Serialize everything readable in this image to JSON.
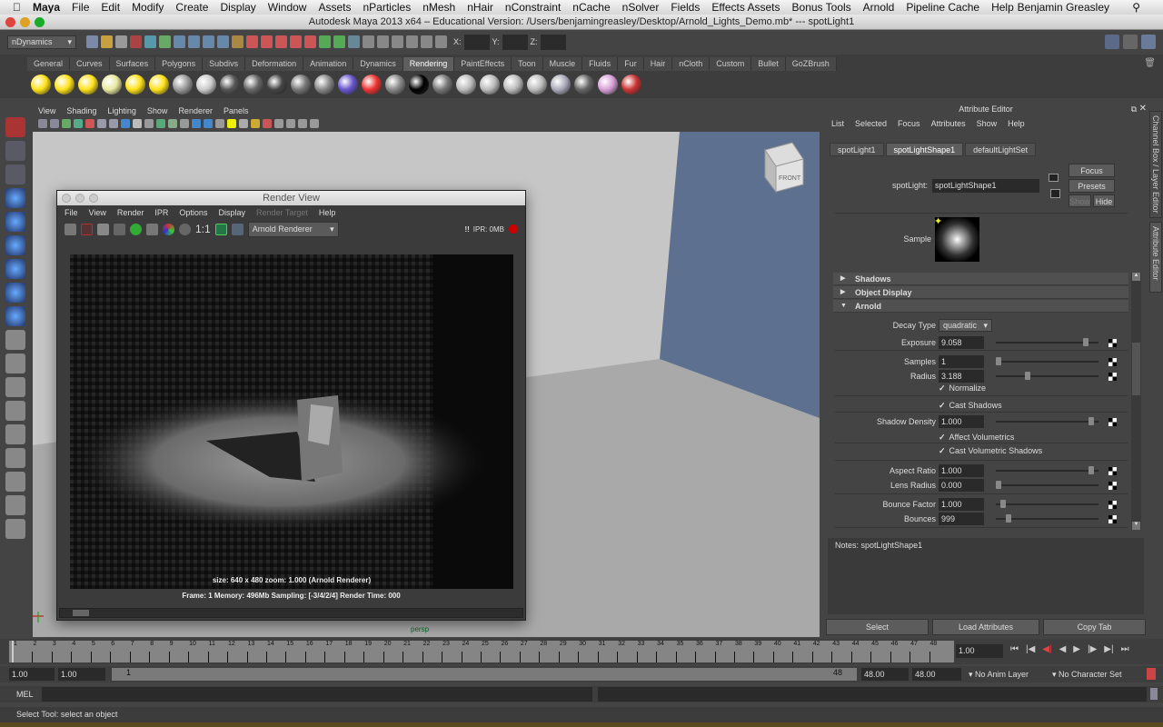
{
  "mac_menu": {
    "app": "Maya",
    "items": [
      "File",
      "Edit",
      "Modify",
      "Create",
      "Display",
      "Window",
      "Assets",
      "nParticles",
      "nMesh",
      "nHair",
      "nConstraint",
      "nCache",
      "nSolver",
      "Fields",
      "Effects Assets",
      "Bonus Tools",
      "Arnold",
      "Pipeline Cache",
      "Help"
    ],
    "user": "Benjamin Greasley"
  },
  "window_title": "Autodesk Maya 2013 x64 – Educational Version: /Users/benjamingreasley/Desktop/Arnold_Lights_Demo.mb*  ---  spotLight1",
  "status_line": {
    "menu_set": "nDynamics",
    "x_label": "X:",
    "y_label": "Y:",
    "z_label": "Z:"
  },
  "shelf": {
    "tabs": [
      "General",
      "Curves",
      "Surfaces",
      "Polygons",
      "Subdivs",
      "Deformation",
      "Animation",
      "Dynamics",
      "Rendering",
      "PaintEffects",
      "Toon",
      "Muscle",
      "Fluids",
      "Fur",
      "Hair",
      "nCloth",
      "Custom",
      "Bullet",
      "GoZBrush"
    ],
    "active": "Rendering",
    "icons": [
      {
        "n": "ambient-light-icon",
        "c": "#ffe21a"
      },
      {
        "n": "directional-light-icon",
        "c": "#ffe21a"
      },
      {
        "n": "point-light-icon",
        "c": "#ffe21a"
      },
      {
        "n": "spot-light-icon",
        "c": "#e8e8a0"
      },
      {
        "n": "area-light-icon",
        "c": "#ffe21a"
      },
      {
        "n": "volume-light-icon",
        "c": "#ffe21a"
      },
      {
        "n": "render-layer-icon",
        "c": "#999"
      },
      {
        "n": "hypershade-icon",
        "c": "#ccc"
      },
      {
        "n": "sphere-shader-icon",
        "c": "#555"
      },
      {
        "n": "blinn-icon",
        "c": "#666"
      },
      {
        "n": "lambert-icon",
        "c": "#444"
      },
      {
        "n": "phong-icon",
        "c": "#777"
      },
      {
        "n": "phonge-icon",
        "c": "#888"
      },
      {
        "n": "anisotropic-icon",
        "c": "#6655cc"
      },
      {
        "n": "ramp-shader-icon",
        "c": "#ee3333"
      },
      {
        "n": "surface-shader-icon",
        "c": "#888"
      },
      {
        "n": "black-shader-icon",
        "c": "#000"
      },
      {
        "n": "use-background-icon",
        "c": "#777"
      },
      {
        "n": "render-icon",
        "c": "#bbb"
      },
      {
        "n": "ipr-render-icon",
        "c": "#bbb"
      },
      {
        "n": "render-settings-icon",
        "c": "#bbb"
      },
      {
        "n": "render-view-icon",
        "c": "#bbb"
      },
      {
        "n": "batch-render-icon",
        "c": "#aab"
      },
      {
        "n": "texture-icon",
        "c": "#666"
      },
      {
        "n": "arnold-ball-icon",
        "c": "#d8a0d8"
      },
      {
        "n": "paint-icon",
        "c": "#c33"
      }
    ]
  },
  "viewport": {
    "menus": [
      "View",
      "Shading",
      "Lighting",
      "Show",
      "Renderer",
      "Panels"
    ],
    "camera": "persp",
    "viewcube": "FRONT"
  },
  "render_view": {
    "title": "Render View",
    "menus": [
      "File",
      "View",
      "Render",
      "IPR",
      "Options",
      "Display",
      "Render Target",
      "Help"
    ],
    "ratio": "1:1",
    "renderer": "Arnold Renderer",
    "ipr": "IPR: 0MB",
    "info1": "size: 640 x 480 zoom: 1.000     (Arnold Renderer)",
    "info2": "Frame: 1    Memory: 496Mb    Sampling: [-3/4/2/4]    Render Time: 000"
  },
  "attribute_editor": {
    "title": "Attribute Editor",
    "menus": [
      "List",
      "Selected",
      "Focus",
      "Attributes",
      "Show",
      "Help"
    ],
    "tabs": [
      "spotLight1",
      "spotLightShape1",
      "defaultLightSet"
    ],
    "active_tab": "spotLightShape1",
    "node_label": "spotLight:",
    "node_name": "spotLightShape1",
    "buttons": {
      "focus": "Focus",
      "presets": "Presets",
      "show": "Show",
      "hide": "Hide"
    },
    "sample_label": "Sample",
    "frames": [
      "Shadows",
      "Object Display",
      "Arnold"
    ],
    "decay_type": {
      "label": "Decay Type",
      "value": "quadratic"
    },
    "exposure": {
      "label": "Exposure",
      "value": "9.058",
      "slider": 0.9
    },
    "samples": {
      "label": "Samples",
      "value": "1",
      "slider": 0.0
    },
    "radius": {
      "label": "Radius",
      "value": "3.188",
      "slider": 0.3
    },
    "normalize": "Normalize",
    "cast_shadows": "Cast Shadows",
    "shadow_density": {
      "label": "Shadow Density",
      "value": "1.000",
      "slider": 0.95
    },
    "affect_volumetrics": "Affect Volumetrics",
    "cast_volumetric_shadows": "Cast Volumetric Shadows",
    "aspect_ratio": {
      "label": "Aspect Ratio",
      "value": "1.000",
      "slider": 0.95
    },
    "lens_radius": {
      "label": "Lens Radius",
      "value": "0.000",
      "slider": 0.0
    },
    "bounce_factor": {
      "label": "Bounce Factor",
      "value": "1.000",
      "slider": 0.05
    },
    "bounces": {
      "label": "Bounces",
      "value": "999",
      "slider": 0.1
    },
    "notes_label": "Notes:",
    "notes_value": "spotLightShape1",
    "bottom_buttons": [
      "Select",
      "Load Attributes",
      "Copy Tab"
    ],
    "side_tabs": [
      "Channel Box / Layer Editor",
      "Attribute Editor"
    ]
  },
  "timeline": {
    "start": 1,
    "end": 48,
    "current": "1.00"
  },
  "range": {
    "start": "1.00",
    "anim_start": "1.00",
    "slider_start": "1",
    "slider_end": "48",
    "anim_end": "48.00",
    "end": "48.00",
    "anim_layer": "No Anim Layer",
    "character_set": "No Character Set"
  },
  "command_line": {
    "label": "MEL"
  },
  "help_line": "Select Tool: select an object"
}
